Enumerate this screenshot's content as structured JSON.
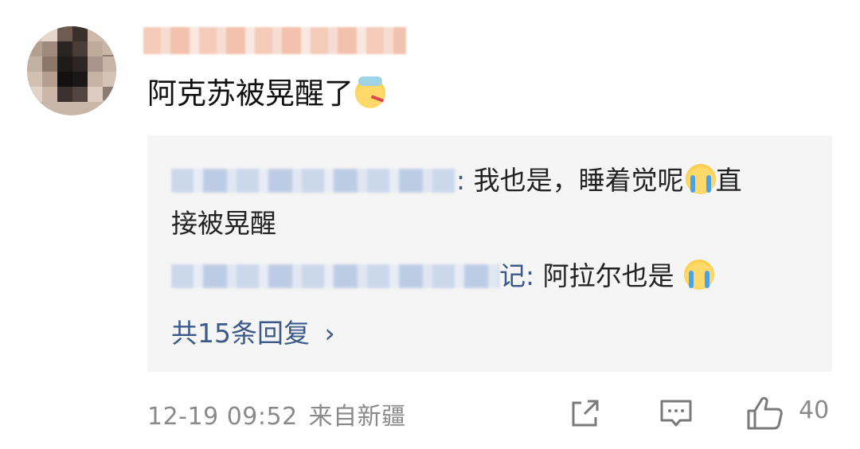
{
  "comment": {
    "text": "阿克苏被晃醒了"
  },
  "replies": [
    {
      "name_suffix": ":",
      "text_line1": " 我也是，睡着觉呢",
      "text_line1_tail": "直",
      "text_line2": "接被晃醒"
    },
    {
      "name_suffix": "记:",
      "text": " 阿拉尔也是 "
    }
  ],
  "more_replies": {
    "label": "共15条回复",
    "chevron": "›"
  },
  "footer": {
    "date": "12-19 09:52",
    "location": "来自新疆"
  },
  "actions": {
    "like_count": "40"
  },
  "icons": {
    "share": "share-icon",
    "comment": "comment-icon",
    "like": "thumbs-up-icon"
  },
  "colors": {
    "link": "#3b5a8a",
    "reply_bg": "#f5f5f5",
    "meta": "#8a8a8a"
  }
}
